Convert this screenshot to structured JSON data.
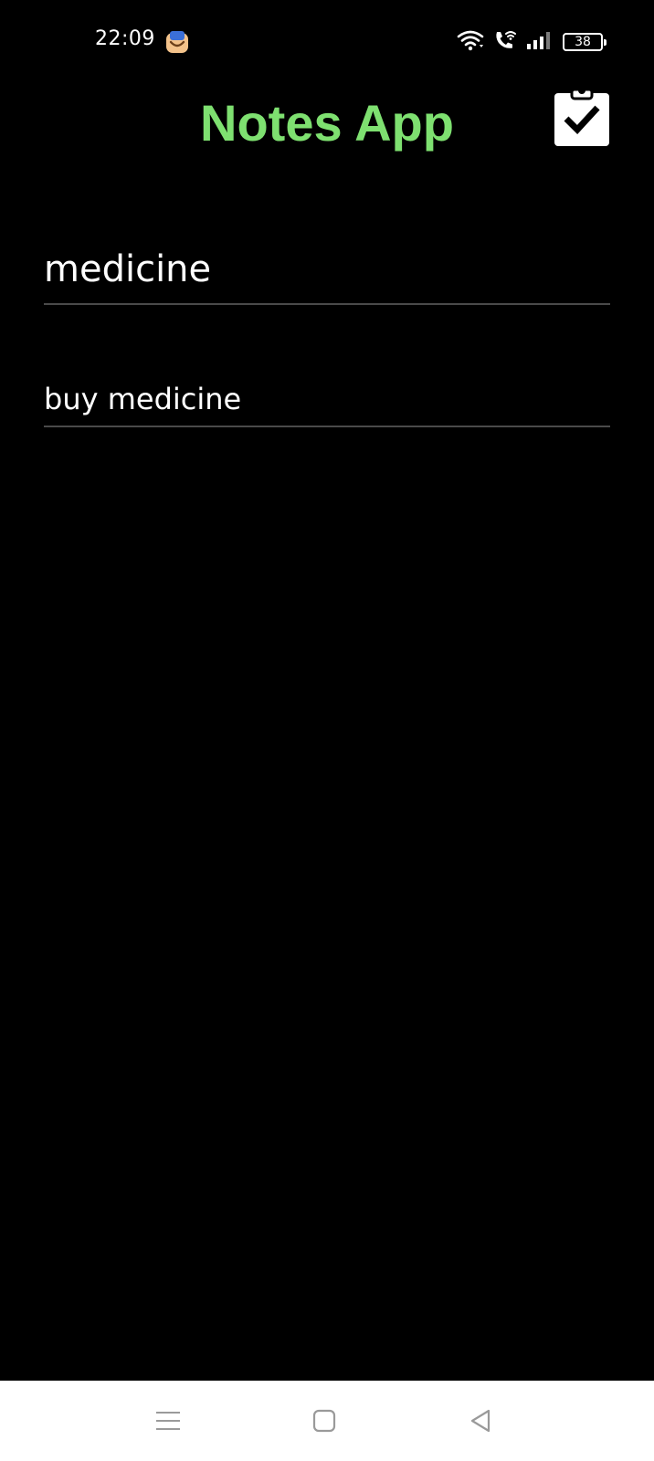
{
  "status_bar": {
    "time": "22:09",
    "app_icon": "mailbox-icon",
    "wifi_icon": "wifi-icon",
    "call_icon": "wifi-call-icon",
    "signal_icon": "signal-icon",
    "battery_level": "38"
  },
  "header": {
    "title": "Notes App",
    "save_icon": "clipboard-check-icon",
    "title_color": "#7ee070"
  },
  "note": {
    "title_value": "medicine",
    "content_value": "buy medicine"
  },
  "nav_bar": {
    "menu_icon": "menu-icon",
    "home_icon": "home-icon",
    "back_icon": "back-icon"
  }
}
